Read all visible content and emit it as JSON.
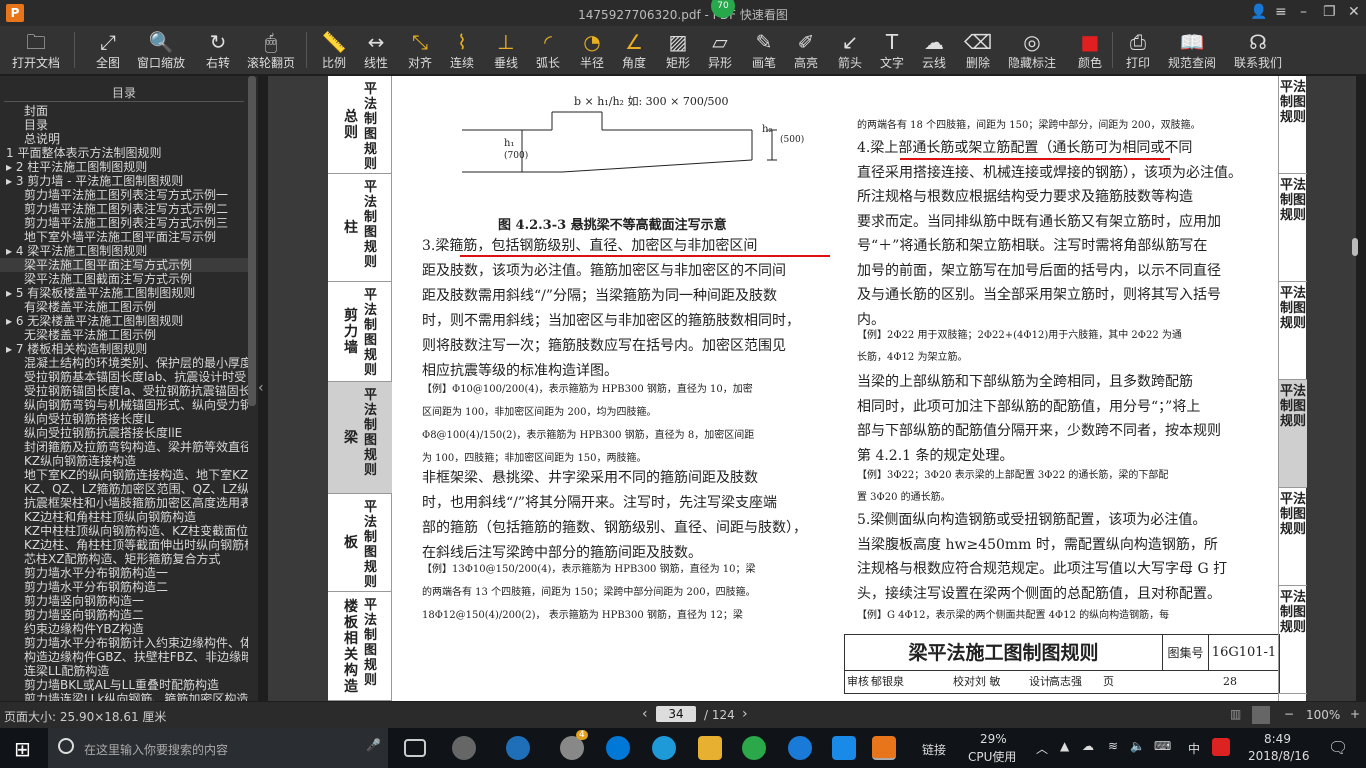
{
  "window": {
    "title": "1475927706320.pdf - PDF 快速看图",
    "badge": "70"
  },
  "toolbar": [
    {
      "label": "打开文档",
      "icon": "folder-icon",
      "glyph": "🗀"
    },
    {
      "label": "全图",
      "icon": "fit-all-icon",
      "glyph": "⤢"
    },
    {
      "label": "窗口缩放",
      "icon": "zoom-icon",
      "glyph": "🔍"
    },
    {
      "label": "右转",
      "icon": "rotate-right-icon",
      "glyph": "↻"
    },
    {
      "label": "滚轮翻页",
      "icon": "mouse-icon",
      "glyph": "🖱"
    },
    {
      "label": "比例",
      "icon": "scale-icon",
      "glyph": "📏"
    },
    {
      "label": "线性",
      "icon": "linear-measure-icon",
      "glyph": "↔"
    },
    {
      "label": "对齐",
      "icon": "align-measure-icon",
      "glyph": "⤡"
    },
    {
      "label": "连续",
      "icon": "continuous-measure-icon",
      "glyph": "⌇"
    },
    {
      "label": "垂线",
      "icon": "perpendicular-icon",
      "glyph": "⊥"
    },
    {
      "label": "弧长",
      "icon": "arc-length-icon",
      "glyph": "◜"
    },
    {
      "label": "半径",
      "icon": "radius-icon",
      "glyph": "◔"
    },
    {
      "label": "角度",
      "icon": "angle-icon",
      "glyph": "∠"
    },
    {
      "label": "矩形",
      "icon": "rectangle-area-icon",
      "glyph": "▨"
    },
    {
      "label": "异形",
      "icon": "polygon-area-icon",
      "glyph": "▱"
    },
    {
      "label": "画笔",
      "icon": "pen-icon",
      "glyph": "✎"
    },
    {
      "label": "高亮",
      "icon": "highlight-icon",
      "glyph": "✐"
    },
    {
      "label": "箭头",
      "icon": "arrow-icon",
      "glyph": "↙"
    },
    {
      "label": "文字",
      "icon": "text-icon",
      "glyph": "T"
    },
    {
      "label": "云线",
      "icon": "cloud-line-icon",
      "glyph": "☁"
    },
    {
      "label": "删除",
      "icon": "eraser-icon",
      "glyph": "⌫"
    },
    {
      "label": "隐藏标注",
      "icon": "hide-annotation-icon",
      "glyph": "◎"
    },
    {
      "label": "颜色",
      "icon": "color-icon",
      "glyph": "■",
      "color": "#e02020"
    },
    {
      "label": "打印",
      "icon": "print-icon",
      "glyph": "⎙"
    },
    {
      "label": "规范查阅",
      "icon": "book-icon",
      "glyph": "📖"
    },
    {
      "label": "联系我们",
      "icon": "headset-icon",
      "glyph": "☊"
    }
  ],
  "sidebar": {
    "header": "目录",
    "items": [
      "封面",
      "目录",
      "总说明",
      "1 平面整体表示方法制图规则",
      "▸ 2 柱平法施工图制图规则",
      "▸ 3 剪力墙 - 平法施工图制图规则",
      "剪力墙平法施工图列表注写方式示例一",
      "剪力墙平法施工图列表注写方式示例二",
      "剪力墙平法施工图列表注写方式示例三",
      "地下室外墙平法施工图平面注写示例",
      "▸ 4 梁平法施工图制图规则",
      "梁平法施工图平面注写方式示例",
      "梁平法施工图截面注写方式示例",
      "▸ 5 有梁板楼盖平法施工图制图规则",
      "有梁楼盖平法施工图示例",
      "▸ 6 无梁楼盖平法施工图制图规则",
      "无梁楼盖平法施工图示例",
      "▸ 7 楼板相关构造制图规则",
      "混凝土结构的环境类别、保护层的最小厚度",
      "受拉钢筋基本锚固长度lab、抗震设计时受",
      "受拉钢筋锚固长度la、受拉钢筋抗震锚固长",
      "纵向钢筋弯钩与机械锚固形式、纵向受力钢",
      "纵向受拉钢筋搭接长度lL",
      "纵向受拉钢筋抗震搭接长度llE",
      "封闭箍筋及拉筋弯钩构造、梁并筋等效直径",
      "KZ纵向钢筋连接构造",
      "地下室KZ的纵向钢筋连接构造、地下室KZ的",
      "KZ、QZ、LZ箍筋加密区范围、QZ、LZ纵向钢",
      "抗震框架柱和小墙肢箍筋加密区高度选用表",
      "KZ边柱和角柱柱顶纵向钢筋构造",
      "KZ中柱柱顶纵向钢筋构造、KZ柱变截面位置",
      "KZ边柱、角柱柱顶等截面伸出时纵向钢筋构",
      "芯柱XZ配筋构造、矩形箍筋复合方式",
      "剪力墙水平分布钢筋构造一",
      "剪力墙水平分布钢筋构造二",
      "剪力墙竖向钢筋构造一",
      "剪力墙竖向钢筋构造二",
      "约束边缘构件YBZ构造",
      "剪力墙水平分布钢筋计入约束边缘构件、体",
      "构造边缘构件GBZ、扶壁柱FBZ、非边缘暗柱",
      "连梁LL配筋构造",
      "剪力墙BKL或AL与LL重叠时配筋构造",
      "剪力墙连梁LLk纵向钢筋、箍筋加密区构造"
    ],
    "selected_index": 11
  },
  "page": {
    "left_tabs": [
      {
        "a": "总则",
        "b": "平法制图规则"
      },
      {
        "a": "柱",
        "b": "平法制图规则"
      },
      {
        "a": "剪力墙",
        "b": "平法制图规则"
      },
      {
        "a": "梁",
        "b": "平法制图规则",
        "active": true
      },
      {
        "a": "板",
        "b": "平法制图规则"
      },
      {
        "a": "楼板相关构造",
        "b": "平法制图规则"
      }
    ],
    "right_tabs": [
      {
        "t": "平法制图规则"
      },
      {
        "t": "平法制图规则"
      },
      {
        "t": "平法制图规则"
      },
      {
        "t": "平法制图规则",
        "active": true
      },
      {
        "t": "平法制图规则"
      },
      {
        "t": "平法制图规则"
      }
    ],
    "figure": {
      "label_top": "b × h₁/h₂ 如: 300 × 700/500",
      "h1": "h₁",
      "h1_val": "(700)",
      "h2": "h₂",
      "h2_val": "(500)",
      "caption": "图 4.2.3-3  悬挑梁不等高截面注写示意"
    },
    "left_col": [
      "3.梁箍筋，包括钢筋级别、直径、加密区与非加密区间",
      "距及肢数，该项为必注值。箍筋加密区与非加密区的不同间",
      "距及肢数需用斜线“/”分隔；当梁箍筋为同一种间距及肢数",
      "时，则不需用斜线；当加密区与非加密区的箍筋肢数相同时，",
      "则将肢数注写一次；箍筋肢数应写在括号内。加密区范围见",
      "相应抗震等级的标准构造详图。"
    ],
    "left_ex1": [
      "【例】Φ10@100/200(4)，表示箍筋为 HPB300 钢筋，直径为 10，加密",
      "区间距为 100，非加密区间距为 200，均为四肢箍。",
      "Φ8@100(4)/150(2)，表示箍筋为 HPB300 钢筋，直径为 8，加密区间距",
      "为 100，四肢箍；非加密区间距为 150，两肢箍。"
    ],
    "left_col2": [
      "非框架梁、悬挑梁、井字梁采用不同的箍筋间距及肢数",
      "时，也用斜线“/”将其分隔开来。注写时，先注写梁支座端",
      "部的箍筋（包括箍筋的箍数、钢筋级别、直径、间距与肢数），",
      "在斜线后注写梁跨中部分的箍筋间距及肢数。"
    ],
    "left_ex2": [
      "【例】13Φ10@150/200(4)，表示箍筋为 HPB300 钢筋，直径为 10；梁",
      "的两端各有 13 个四肢箍，间距为 150；梁跨中部分间距为 200，四肢箍。",
      "18Φ12@150(4)/200(2)，  表示箍筋为 HPB300 钢筋，直径为 12；梁"
    ],
    "right_top": "的两端各有 18 个四肢箍，间距为 150；梁跨中部分，间距为 200，双肢箍。",
    "right_col": [
      "4.梁上部通长筋或架立筋配置（通长筋可为相同或不同",
      "直径采用搭接连接、机械连接或焊接的钢筋），该项为必注值。",
      "所注规格与根数应根据结构受力要求及箍筋肢数等构造",
      "要求而定。当同排纵筋中既有通长筋又有架立筋时，应用加",
      "号“＋”将通长筋和架立筋相联。注写时需将角部纵筋写在",
      "加号的前面，架立筋写在加号后面的括号内，以示不同直径",
      "及与通长筋的区别。当全部采用架立筋时，则将其写入括号",
      "内。"
    ],
    "right_ex1": [
      "【例】2Φ22 用于双肢箍；2Φ22+(4Φ12)用于六肢箍，其中 2Φ22 为通",
      "长筋，4Φ12 为架立筋。"
    ],
    "right_col2": [
      "当梁的上部纵筋和下部纵筋为全跨相同，且多数跨配筋",
      "相同时，此项可加注下部纵筋的配筋值，用分号“；”将上",
      "部与下部纵筋的配筋值分隔开来，少数跨不同者，按本规则",
      "第 4.2.1 条的规定处理。"
    ],
    "right_ex2": [
      "【例】3Φ22；3Φ20 表示梁的上部配置 3Φ22 的通长筋，梁的下部配",
      "置 3Φ20 的通长筋。"
    ],
    "right_col3": [
      "5.梁侧面纵向构造钢筋或受扭钢筋配置，该项为必注值。",
      "当梁腹板高度 hw≥450mm 时，需配置纵向构造钢筋，所",
      "注规格与根数应符合规范规定。此项注写值以大写字母 G 打",
      "头，接续注写设置在梁两个侧面的总配筋值，且对称配置。"
    ],
    "right_ex3": "【例】G 4Φ12，表示梁的两个侧面共配置 4Φ12 的纵向构造钢筋，每",
    "footer": {
      "title": "梁平法施工图制图规则",
      "atlas_label": "图集号",
      "atlas_no": "16G101-1",
      "row2": [
        "审核",
        "郁银泉",
        "校对",
        "刘  敏",
        "设计",
        "高志强",
        "页"
      ],
      "page_no": "28"
    }
  },
  "status": {
    "page_size": "页面大小: 25.90×18.61 厘米",
    "current_page": "34",
    "total_pages": "/ 124",
    "zoom": "100%"
  },
  "taskbar": {
    "search_placeholder": "在这里输入你要搜索的内容",
    "link": "链接",
    "cpu_pct": "29%",
    "cpu_label": "CPU使用",
    "ime": "中",
    "time": "8:49",
    "date": "2018/8/16",
    "notif": "4"
  }
}
